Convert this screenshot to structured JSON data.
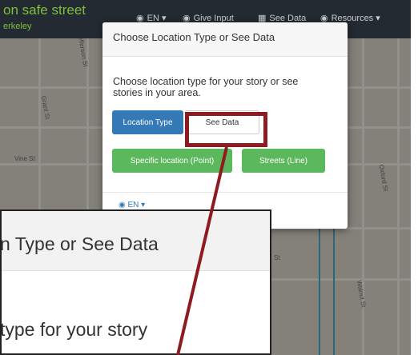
{
  "app": {
    "brand_title": "on safe street",
    "brand_subtitle": "erkeley",
    "nav": [
      {
        "icon": "i-icon",
        "glyph": "◉",
        "label": "EN ▾"
      },
      {
        "icon": "map-icon",
        "glyph": "◉",
        "label": "Give Input"
      },
      {
        "icon": "table-icon",
        "glyph": "▦",
        "label": "See Data"
      },
      {
        "icon": "info-icon",
        "glyph": "◉",
        "label": "Resources ▾"
      }
    ]
  },
  "map": {
    "streets": [
      "Jefferson St",
      "Grant St",
      "Vine St",
      "Oxford St",
      "Walnut St"
    ],
    "cut_label": "St"
  },
  "modal": {
    "title": "Choose Location Type or See Data",
    "body": "Choose location type for your story or see stories in your area.",
    "tabs": [
      {
        "label": "Location Type",
        "selected": true
      },
      {
        "label": "See Data",
        "selected": false
      }
    ],
    "actions": [
      "Specific location (Point)",
      "Streets (Line)"
    ],
    "language": {
      "icon": "globe-icon",
      "label": "EN ▾"
    }
  },
  "zoom": {
    "title": "n Type or See Data",
    "text": "type for your story"
  },
  "colors": {
    "annotation": "#8e1b22",
    "primary": "#337ab7",
    "success": "#5cb85c",
    "brand": "#7fbf3f"
  }
}
